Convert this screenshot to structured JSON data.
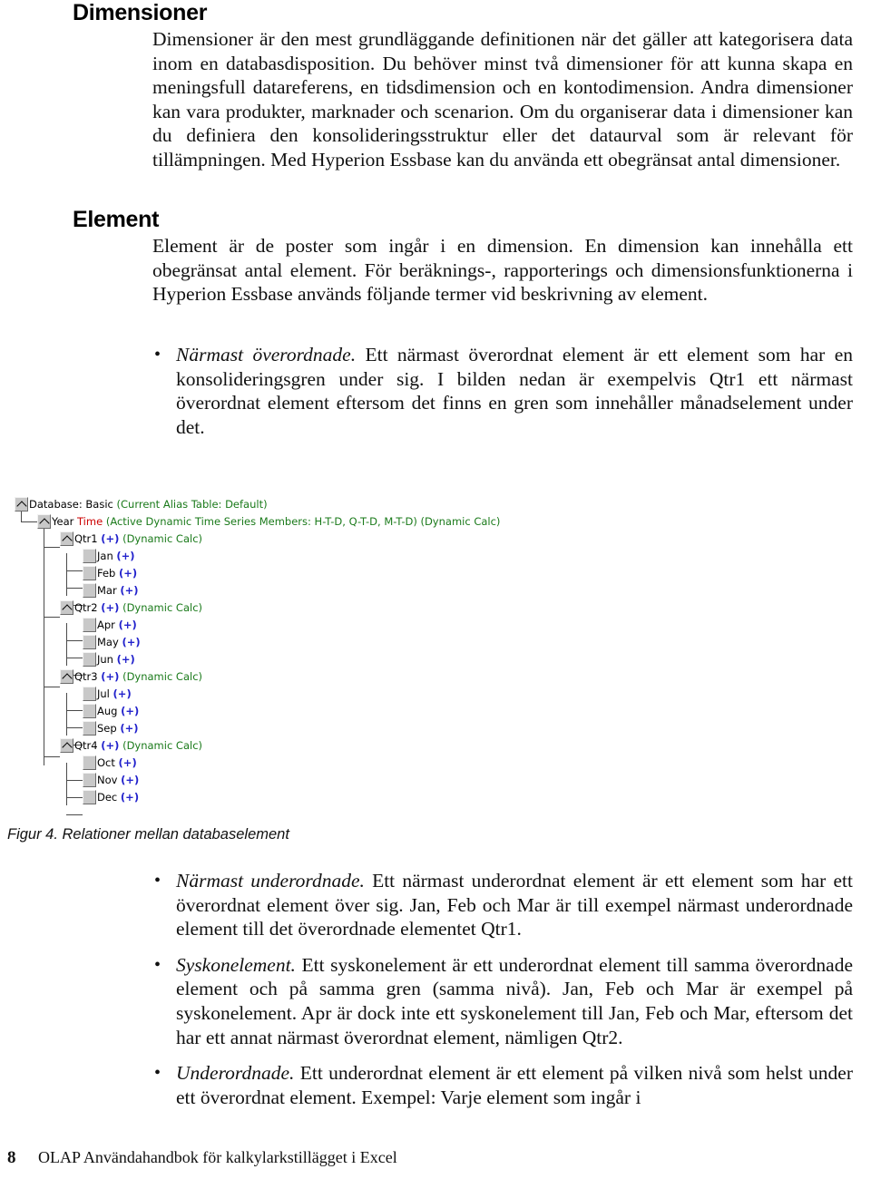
{
  "page": {
    "number": "8",
    "footer_title": "OLAP Användahandbok för kalkylarkstillägget i Excel"
  },
  "sections": [
    {
      "heading": "Dimensioner",
      "body": "Dimensioner är den mest grundläggande definitionen när det gäller att kategorisera data inom en databasdisposition. Du behöver minst två dimensioner för att kunna skapa en meningsfull datareferens, en tidsdimension och en kontodimension. Andra dimensioner kan vara produkter, marknader och scenarion. Om du organiserar data i dimensioner kan du definiera den konsolideringsstruktur eller det dataurval som är relevant för tillämpningen. Med Hyperion Essbase kan du använda ett obegränsat antal dimensioner."
    },
    {
      "heading": "Element",
      "body": "Element är de poster som ingår i en dimension. En dimension kan innehålla ett obegränsat antal element. För beräknings-, rapporterings och dimensionsfunktionerna i Hyperion Essbase används följande termer vid beskrivning av element."
    }
  ],
  "bullets_before_figure": [
    {
      "term": "Närmast överordnade.",
      "text": " Ett närmast överordnat element är ett element som har en konsolideringsgren under sig. I bilden nedan är exempelvis Qtr1 ett närmast överordnat element eftersom det finns en gren som innehåller månadselement under det."
    }
  ],
  "bullets_after_figure": [
    {
      "term": "Närmast underordnade.",
      "text": " Ett närmast underordnat element är ett element som har ett överordnat element över sig. Jan, Feb och Mar är till exempel närmast underordnade element till det överordnade elementet Qtr1."
    },
    {
      "term": "Syskonelement.",
      "text": " Ett syskonelement är ett underordnat element till samma överordnade element och på samma gren (samma nivå). Jan, Feb och Mar är exempel på syskonelement. Apr är dock inte ett syskonelement till Jan, Feb och Mar, eftersom det har ett annat närmast överordnat element, nämligen Qtr2."
    },
    {
      "term": "Underordnade.",
      "text": " Ett underordnat element är ett element på vilken nivå som helst under ett överordnat element. Exempel: Varje element som ingår i"
    }
  ],
  "figure": {
    "caption": "Figur 4. Relationer mellan databaselement",
    "colors": {
      "name": "#000000",
      "alias": "#cc0000",
      "consolidation": "#2222cc",
      "note": "#1a7a1a",
      "icon_fill": "#c8c8c8",
      "icon_border": "#6b6b6b",
      "connector": "#4a4a4a"
    },
    "tree": [
      {
        "id": "database",
        "icon": "branch-node-icon",
        "depth": 0,
        "name": "Database: Basic",
        "alias": "",
        "consolidation": "",
        "note": "(Current Alias Table: Default)"
      },
      {
        "id": "year",
        "icon": "branch-node-icon",
        "depth": 1,
        "name": "Year",
        "alias": "Time",
        "consolidation": "",
        "note": "(Active Dynamic Time Series Members: H-T-D, Q-T-D, M-T-D) (Dynamic Calc)"
      },
      {
        "id": "qtr1",
        "icon": "branch-node-icon",
        "depth": 2,
        "name": "Qtr1",
        "alias": "",
        "consolidation": "(+)",
        "note": "(Dynamic Calc)"
      },
      {
        "id": "jan",
        "icon": "leaf-node-icon",
        "depth": 3,
        "name": "Jan",
        "alias": "",
        "consolidation": "(+)",
        "note": ""
      },
      {
        "id": "feb",
        "icon": "leaf-node-icon",
        "depth": 3,
        "name": "Feb",
        "alias": "",
        "consolidation": "(+)",
        "note": ""
      },
      {
        "id": "mar",
        "icon": "leaf-node-icon",
        "depth": 3,
        "name": "Mar",
        "alias": "",
        "consolidation": "(+)",
        "note": ""
      },
      {
        "id": "qtr2",
        "icon": "branch-node-icon",
        "depth": 2,
        "name": "Qtr2",
        "alias": "",
        "consolidation": "(+)",
        "note": "(Dynamic Calc)"
      },
      {
        "id": "apr",
        "icon": "leaf-node-icon",
        "depth": 3,
        "name": "Apr",
        "alias": "",
        "consolidation": "(+)",
        "note": ""
      },
      {
        "id": "may",
        "icon": "leaf-node-icon",
        "depth": 3,
        "name": "May",
        "alias": "",
        "consolidation": "(+)",
        "note": ""
      },
      {
        "id": "jun",
        "icon": "leaf-node-icon",
        "depth": 3,
        "name": "Jun",
        "alias": "",
        "consolidation": "(+)",
        "note": ""
      },
      {
        "id": "qtr3",
        "icon": "branch-node-icon",
        "depth": 2,
        "name": "Qtr3",
        "alias": "",
        "consolidation": "(+)",
        "note": "(Dynamic Calc)"
      },
      {
        "id": "jul",
        "icon": "leaf-node-icon",
        "depth": 3,
        "name": "Jul",
        "alias": "",
        "consolidation": "(+)",
        "note": ""
      },
      {
        "id": "aug",
        "icon": "leaf-node-icon",
        "depth": 3,
        "name": "Aug",
        "alias": "",
        "consolidation": "(+)",
        "note": ""
      },
      {
        "id": "sep",
        "icon": "leaf-node-icon",
        "depth": 3,
        "name": "Sep",
        "alias": "",
        "consolidation": "(+)",
        "note": ""
      },
      {
        "id": "qtr4",
        "icon": "branch-node-icon",
        "depth": 2,
        "name": "Qtr4",
        "alias": "",
        "consolidation": "(+)",
        "note": "(Dynamic Calc)"
      },
      {
        "id": "oct",
        "icon": "leaf-node-icon",
        "depth": 3,
        "name": "Oct",
        "alias": "",
        "consolidation": "(+)",
        "note": ""
      },
      {
        "id": "nov",
        "icon": "leaf-node-icon",
        "depth": 3,
        "name": "Nov",
        "alias": "",
        "consolidation": "(+)",
        "note": ""
      },
      {
        "id": "dec",
        "icon": "leaf-node-icon",
        "depth": 3,
        "name": "Dec",
        "alias": "",
        "consolidation": "(+)",
        "note": ""
      }
    ]
  }
}
